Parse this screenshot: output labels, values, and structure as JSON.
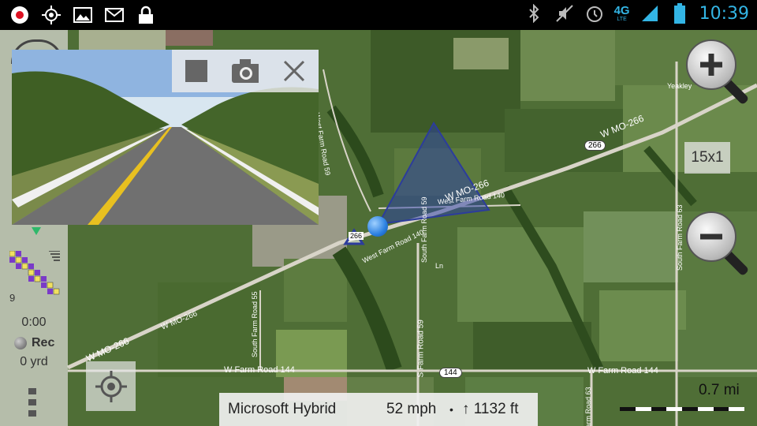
{
  "status_bar": {
    "left_icons": [
      "record-icon",
      "gps-icon",
      "gallery-icon",
      "gmail-icon",
      "lock-icon"
    ],
    "right_icons": [
      "bluetooth-icon",
      "mute-icon",
      "alarm-icon",
      "network-4g-icon",
      "signal-icon",
      "battery-icon"
    ],
    "network_label": "4G",
    "network_sub": "LTE",
    "time": "10:39"
  },
  "map": {
    "road_labels": {
      "w_mo_266_right": "W MO-266",
      "w_mo_266_mid": "W MO-266",
      "w_mo_266_left": "W MO-266",
      "w_mo_266_bottom": "W MO-266",
      "route_266_a": "266",
      "route_266_b": "266",
      "route_144": "144",
      "w_farm_road_144_left": "W Farm Road 144",
      "w_farm_road_144_right": "W Farm Road 144",
      "west_farm_road_140_a": "West Farm Road 140",
      "west_farm_road_140_b": "West Farm Road 140",
      "south_farm_road_59": "South Farm Road 59",
      "s_farm_road_59": "S Farm Road 59",
      "south_farm_road_55": "South Farm Road 55",
      "south_farm_road_63": "South Farm Road 63",
      "farm_road_63": "Farm Road 63",
      "west_farm_road_59": "West Farm Road 59",
      "yeakley": "Yeakley",
      "ln": "Ln"
    }
  },
  "left_panel": {
    "satellite_count": "9",
    "elapsed_time": "0:00",
    "rec_label": "Rec",
    "distance": "0 yrd"
  },
  "camera_controls": {
    "stop_icon": "stop-icon",
    "camera_icon": "camera-icon",
    "close_icon": "close-icon"
  },
  "zoom_level": "15x1",
  "info_bar": {
    "map_source": "Microsoft Hybrid",
    "speed": "52 mph",
    "separator": "•",
    "altitude": "↑ 1132 ft"
  },
  "scale": {
    "label": "0.7 mi"
  },
  "colors": {
    "accent": "#33b5e5",
    "location_dot": "#2a7fe0",
    "direction_cone": "#2c3c9c",
    "grid_purple": "#7a3ac8",
    "grid_yellow": "#f0e060"
  }
}
